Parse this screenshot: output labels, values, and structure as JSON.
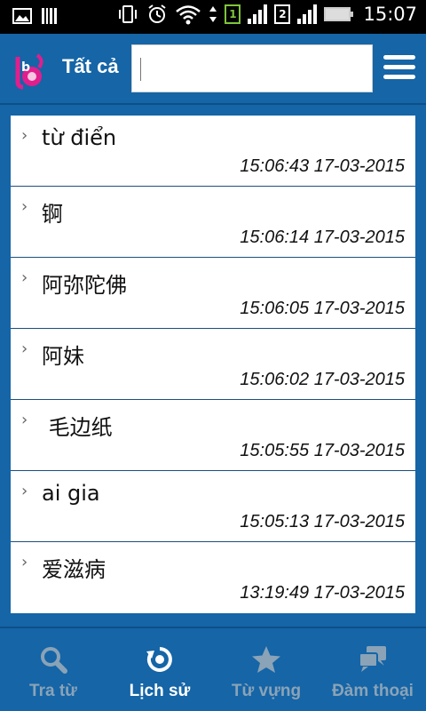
{
  "status_bar": {
    "time": "15:07",
    "sim1": "1",
    "sim2": "2"
  },
  "header": {
    "title": "Tất cả",
    "search": {
      "value": "",
      "placeholder": ""
    }
  },
  "history": [
    {
      "term": "từ điển",
      "timestamp": "15:06:43 17-03-2015"
    },
    {
      "term": "锕",
      "timestamp": "15:06:14 17-03-2015"
    },
    {
      "term": "阿弥陀佛",
      "timestamp": "15:06:05 17-03-2015"
    },
    {
      "term": "阿妹",
      "timestamp": "15:06:02 17-03-2015"
    },
    {
      "term": " 毛边纸",
      "timestamp": "15:05:55 17-03-2015"
    },
    {
      "term": "ai gia",
      "timestamp": "15:05:13 17-03-2015"
    },
    {
      "term": "爱滋病",
      "timestamp": "13:19:49 17-03-2015"
    }
  ],
  "bottom_nav": [
    {
      "label": "Tra từ",
      "icon": "search-icon",
      "active": false
    },
    {
      "label": "Lịch sử",
      "icon": "history-icon",
      "active": true
    },
    {
      "label": "Từ vựng",
      "icon": "star-icon",
      "active": false
    },
    {
      "label": "Đàm thoại",
      "icon": "chat-icon",
      "active": false
    }
  ],
  "colors": {
    "primary": "#1565a7",
    "inactive_label": "#8aa3b7",
    "active_label": "#ffffff",
    "divider": "#1c4f7d"
  }
}
